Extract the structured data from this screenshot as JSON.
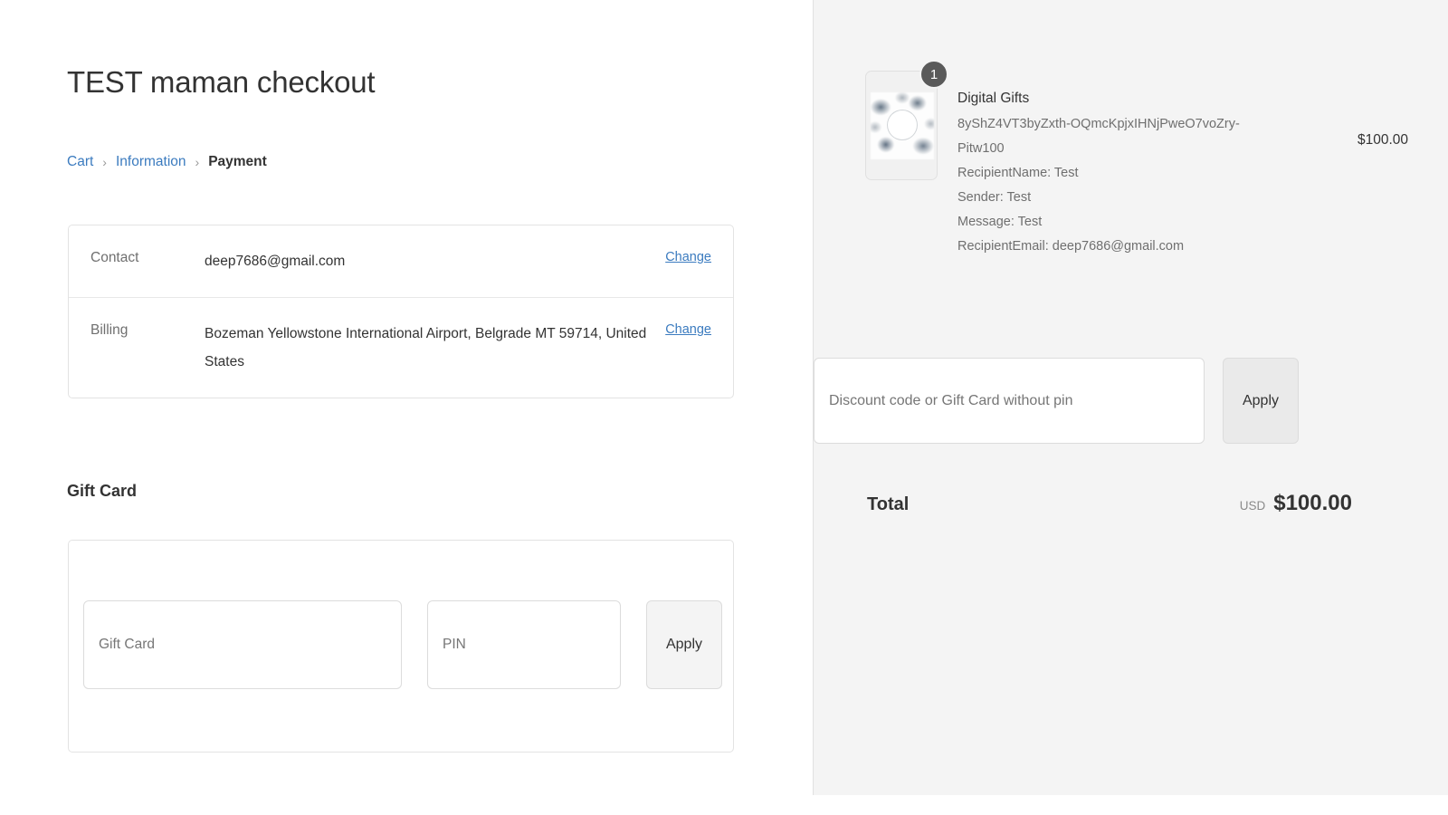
{
  "page": {
    "title": "TEST maman checkout"
  },
  "breadcrumb": {
    "cart": "Cart",
    "separator": "›",
    "information": "Information",
    "current": "Payment"
  },
  "review": {
    "rows": [
      {
        "label": "Contact",
        "value": "deep7686@gmail.com",
        "change_label": "Change"
      },
      {
        "label": "Billing",
        "value": "Bozeman Yellowstone International Airport, Belgrade MT 59714, United States",
        "change_label": "Change"
      }
    ]
  },
  "gift_card": {
    "heading": "Gift Card",
    "code_placeholder": "Gift Card",
    "code_value": "",
    "pin_placeholder": "PIN",
    "pin_value": "",
    "apply_label": "Apply"
  },
  "summary": {
    "item": {
      "quantity_badge": "1",
      "title": "Digital Gifts",
      "variant": "8yShZ4VT3byZxth-OQmcKpjxIHNjPweO7voZry-Pitw100",
      "properties": [
        "RecipientName: Test",
        "Sender: Test",
        "Message: Test",
        "RecipientEmail: deep7686@gmail.com"
      ],
      "price": "$100.00"
    },
    "discount": {
      "placeholder": "Discount code or Gift Card without pin",
      "value": "",
      "apply_label": "Apply"
    },
    "total": {
      "label": "Total",
      "currency": "USD",
      "amount": "$100.00"
    }
  },
  "colors": {
    "link": "#3b7bbf",
    "text": "#333333",
    "muted": "#6f6f6f",
    "panel_bg": "#f4f4f4",
    "badge_bg": "#5a5a5a"
  }
}
